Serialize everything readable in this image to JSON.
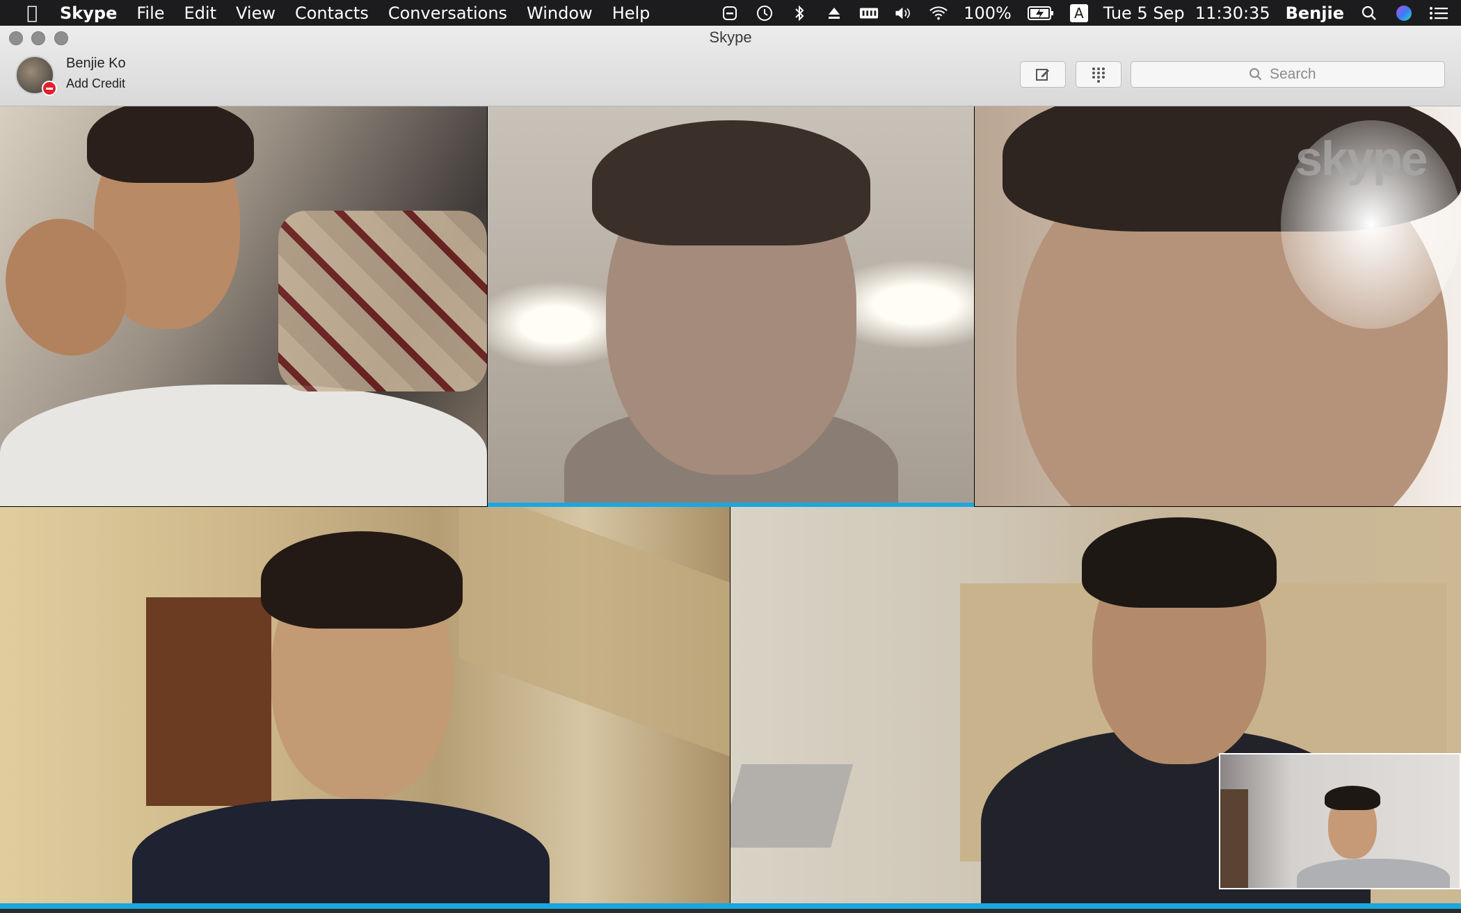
{
  "menubar": {
    "apple_icon": "apple-logo-icon",
    "app_name": "Skype",
    "items": [
      "File",
      "Edit",
      "View",
      "Contacts",
      "Conversations",
      "Window",
      "Help"
    ],
    "battery_percent": "100%",
    "input_source": "A",
    "datetime": "Tue 5 Sep  11:30:35",
    "user": "Benjie"
  },
  "window": {
    "title": "Skype"
  },
  "profile": {
    "name": "Benjie Ko",
    "credit_link": "Add Credit"
  },
  "toolbar": {
    "compose_icon": "compose-icon",
    "dialpad_icon": "dialpad-icon"
  },
  "search": {
    "placeholder": "Search"
  },
  "video": {
    "watermark": "skype",
    "participant_count": 5
  },
  "colors": {
    "accent": "#1aa7e0",
    "presence_busy": "#e0202b"
  }
}
